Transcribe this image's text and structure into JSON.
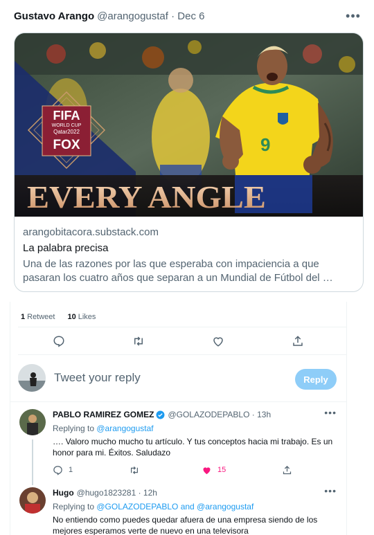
{
  "tweet": {
    "author_name": "Gustavo Arango",
    "author_meta": "@arangogustaf · Dec 6",
    "more_icon": "more-horizontal-icon"
  },
  "card": {
    "image_alt_text": "EVERY ANGLE",
    "logo_fifa": "FIFA",
    "logo_world_cup": "WORLD CUP",
    "logo_qatar": "Qatar2022",
    "logo_fox": "FOX",
    "jersey_number": "9",
    "domain": "arangobitacora.substack.com",
    "title": "La palabra precisa",
    "description": "Una de las razones por las que esperaba con impaciencia a que pasaran los cuatro años que separan a un Mundial de Fútbol del …"
  },
  "engagement": {
    "retweet_count": "1",
    "retweet_label": "Retweet",
    "like_count": "10",
    "like_label": "Likes"
  },
  "actions": [
    "reply-icon",
    "retweet-icon",
    "like-icon",
    "share-icon"
  ],
  "reply_box": {
    "placeholder": "Tweet your reply",
    "button_label": "Reply"
  },
  "replies": [
    {
      "name": "PABLO RAMIREZ GOMEZ",
      "verified": true,
      "meta": "@GOLAZODEPABLO · 13h",
      "replying_prefix": "Replying to ",
      "replying_to": "@arangogustaf",
      "text": "…. Valoro mucho mucho tu artículo. Y tus conceptos hacia mi trabajo. Es un honor para mi. Éxitos. Saludazo",
      "reply_count": "1",
      "retweet_count": "",
      "like_count": "15",
      "liked": true
    },
    {
      "name": "Hugo",
      "verified": false,
      "meta": "@hugo1823281 · 12h",
      "replying_prefix": "Replying to ",
      "replying_to": "@GOLAZODEPABLO and @arangogustaf",
      "text": "No entiendo como puedes quedar afuera de una empresa siendo de los mejores esperamos verte de nuevo en una televisora"
    }
  ],
  "colors": {
    "accent": "#1d9bf0",
    "like": "#f91880",
    "reply_button": "#8ecdf8",
    "muted_text": "#536471",
    "jersey_yellow": "#f3d51b",
    "shorts_blue": "#1f3fa0",
    "fifa_maroon": "#8b1f34"
  }
}
